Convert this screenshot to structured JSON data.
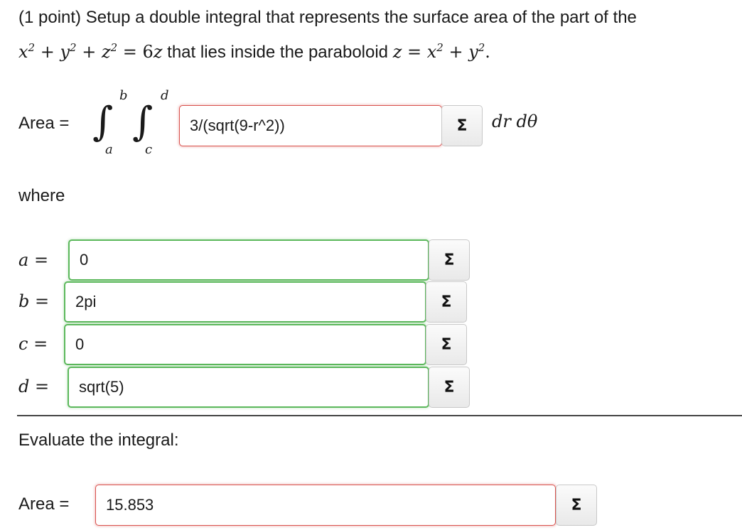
{
  "problem": {
    "line1": "(1 point) Setup a double integral that represents the surface area of the part of the",
    "eq_part": "x² + y² + z² = 6z",
    "line2_text": "that lies inside the paraboloid",
    "paraboloid": "z = x² + y².",
    "area_label": "Area =",
    "where_label": "where",
    "differentials": "dr dθ",
    "evaluate_label": "Evaluate the integral:",
    "sigma": "Σ"
  },
  "integral": {
    "outer_upper": "b",
    "outer_lower": "a",
    "inner_upper": "d",
    "inner_lower": "c",
    "integrand": "3/(sqrt(9-r^2))"
  },
  "bounds": [
    {
      "var": "a =",
      "value": "0"
    },
    {
      "var": "b =",
      "value": "2pi"
    },
    {
      "var": "c =",
      "value": "0"
    },
    {
      "var": "d =",
      "value": "sqrt(5)"
    }
  ],
  "result": {
    "label": "Area =",
    "value": "15.853"
  }
}
